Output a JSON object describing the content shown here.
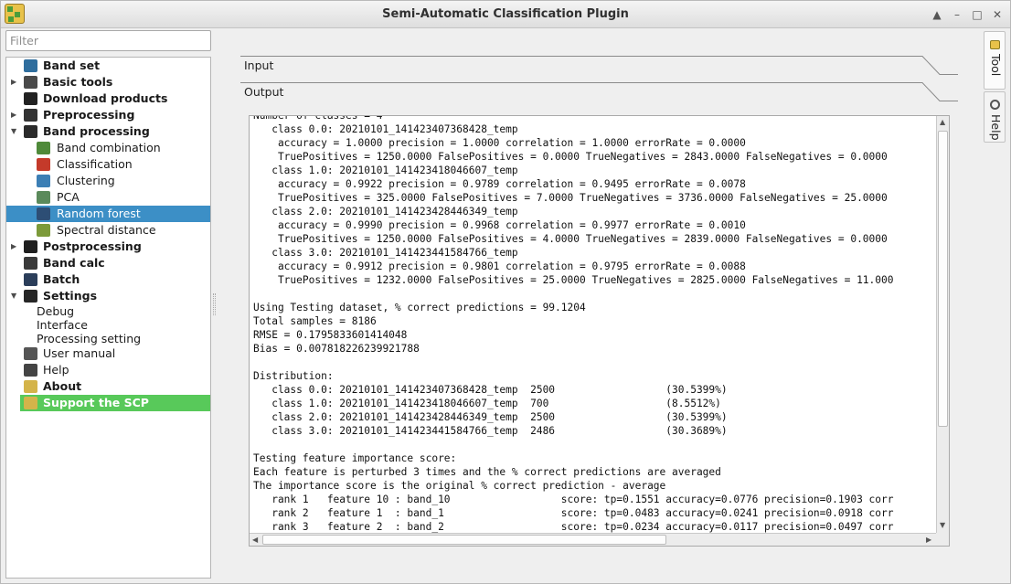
{
  "window": {
    "title": "Semi-Automatic Classification Plugin"
  },
  "filter": {
    "placeholder": "Filter"
  },
  "tree": {
    "items": [
      {
        "label": "Band set",
        "bold": true,
        "indent": 0,
        "arrow": "",
        "icon": "band-set-icon",
        "state": ""
      },
      {
        "label": "Basic tools",
        "bold": true,
        "indent": 0,
        "arrow": "right",
        "icon": "basic-tools-icon",
        "state": ""
      },
      {
        "label": "Download products",
        "bold": true,
        "indent": 0,
        "arrow": "",
        "icon": "download-icon",
        "state": ""
      },
      {
        "label": "Preprocessing",
        "bold": true,
        "indent": 0,
        "arrow": "right",
        "icon": "preprocessing-icon",
        "state": ""
      },
      {
        "label": "Band processing",
        "bold": true,
        "indent": 0,
        "arrow": "down",
        "icon": "band-processing-icon",
        "state": ""
      },
      {
        "label": "Band combination",
        "bold": false,
        "indent": 1,
        "arrow": "",
        "icon": "band-combination-icon",
        "state": ""
      },
      {
        "label": "Classification",
        "bold": false,
        "indent": 1,
        "arrow": "",
        "icon": "classification-icon",
        "state": ""
      },
      {
        "label": "Clustering",
        "bold": false,
        "indent": 1,
        "arrow": "",
        "icon": "clustering-icon",
        "state": ""
      },
      {
        "label": "PCA",
        "bold": false,
        "indent": 1,
        "arrow": "",
        "icon": "pca-icon",
        "state": ""
      },
      {
        "label": "Random forest",
        "bold": false,
        "indent": 1,
        "arrow": "",
        "icon": "random-forest-icon",
        "state": "selected"
      },
      {
        "label": "Spectral distance",
        "bold": false,
        "indent": 1,
        "arrow": "",
        "icon": "spectral-distance-icon",
        "state": ""
      },
      {
        "label": "Postprocessing",
        "bold": true,
        "indent": 0,
        "arrow": "right",
        "icon": "postprocessing-icon",
        "state": ""
      },
      {
        "label": "Band calc",
        "bold": true,
        "indent": 0,
        "arrow": "",
        "icon": "band-calc-icon",
        "state": ""
      },
      {
        "label": "Batch",
        "bold": true,
        "indent": 0,
        "arrow": "",
        "icon": "batch-icon",
        "state": ""
      },
      {
        "label": "Settings",
        "bold": true,
        "indent": 0,
        "arrow": "down",
        "icon": "settings-icon",
        "state": ""
      },
      {
        "label": "Debug",
        "bold": false,
        "indent": 2,
        "arrow": "",
        "icon": "",
        "state": ""
      },
      {
        "label": "Interface",
        "bold": false,
        "indent": 2,
        "arrow": "",
        "icon": "",
        "state": ""
      },
      {
        "label": "Processing setting",
        "bold": false,
        "indent": 2,
        "arrow": "",
        "icon": "",
        "state": ""
      },
      {
        "label": "User manual",
        "bold": false,
        "indent": 0,
        "arrow": "",
        "icon": "user-manual-icon",
        "state": ""
      },
      {
        "label": "Help",
        "bold": false,
        "indent": 0,
        "arrow": "",
        "icon": "help-icon",
        "state": ""
      },
      {
        "label": "About",
        "bold": true,
        "indent": 0,
        "arrow": "",
        "icon": "about-icon",
        "state": ""
      },
      {
        "label": "Support the SCP",
        "bold": true,
        "indent": 0,
        "arrow": "",
        "icon": "support-icon",
        "state": "green"
      }
    ]
  },
  "sections": {
    "input": "Input",
    "output": "Output"
  },
  "output_lines": [
    "Number of classes = 4",
    "   class 0.0: 20210101_141423407368428_temp",
    "    accuracy = 1.0000 precision = 1.0000 correlation = 1.0000 errorRate = 0.0000",
    "    TruePositives = 1250.0000 FalsePositives = 0.0000 TrueNegatives = 2843.0000 FalseNegatives = 0.0000",
    "   class 1.0: 20210101_141423418046607_temp",
    "    accuracy = 0.9922 precision = 0.9789 correlation = 0.9495 errorRate = 0.0078",
    "    TruePositives = 325.0000 FalsePositives = 7.0000 TrueNegatives = 3736.0000 FalseNegatives = 25.0000",
    "   class 2.0: 20210101_141423428446349_temp",
    "    accuracy = 0.9990 precision = 0.9968 correlation = 0.9977 errorRate = 0.0010",
    "    TruePositives = 1250.0000 FalsePositives = 4.0000 TrueNegatives = 2839.0000 FalseNegatives = 0.0000",
    "   class 3.0: 20210101_141423441584766_temp",
    "    accuracy = 0.9912 precision = 0.9801 correlation = 0.9795 errorRate = 0.0088",
    "    TruePositives = 1232.0000 FalsePositives = 25.0000 TrueNegatives = 2825.0000 FalseNegatives = 11.000",
    "",
    "Using Testing dataset, % correct predictions = 99.1204",
    "Total samples = 8186",
    "RMSE = 0.1795833601414048",
    "Bias = 0.007818226239921788",
    "",
    "Distribution:",
    "   class 0.0: 20210101_141423407368428_temp  2500                  (30.5399%)",
    "   class 1.0: 20210101_141423418046607_temp  700                   (8.5512%)",
    "   class 2.0: 20210101_141423428446349_temp  2500                  (30.5399%)",
    "   class 3.0: 20210101_141423441584766_temp  2486                  (30.3689%)",
    "",
    "Testing feature importance score:",
    "Each feature is perturbed 3 times and the % correct predictions are averaged",
    "The importance score is the original % correct prediction - average",
    "   rank 1   feature 10 : band_10                  score: tp=0.1551 accuracy=0.0776 precision=0.1903 corr",
    "   rank 2   feature 1  : band_1                   score: tp=0.0483 accuracy=0.0241 precision=0.0918 corr",
    "   rank 3   feature 2  : band_2                   score: tp=0.0234 accuracy=0.0117 precision=0.0497 corr"
  ],
  "side_tabs": {
    "tool": "Tool",
    "help": "Help"
  }
}
